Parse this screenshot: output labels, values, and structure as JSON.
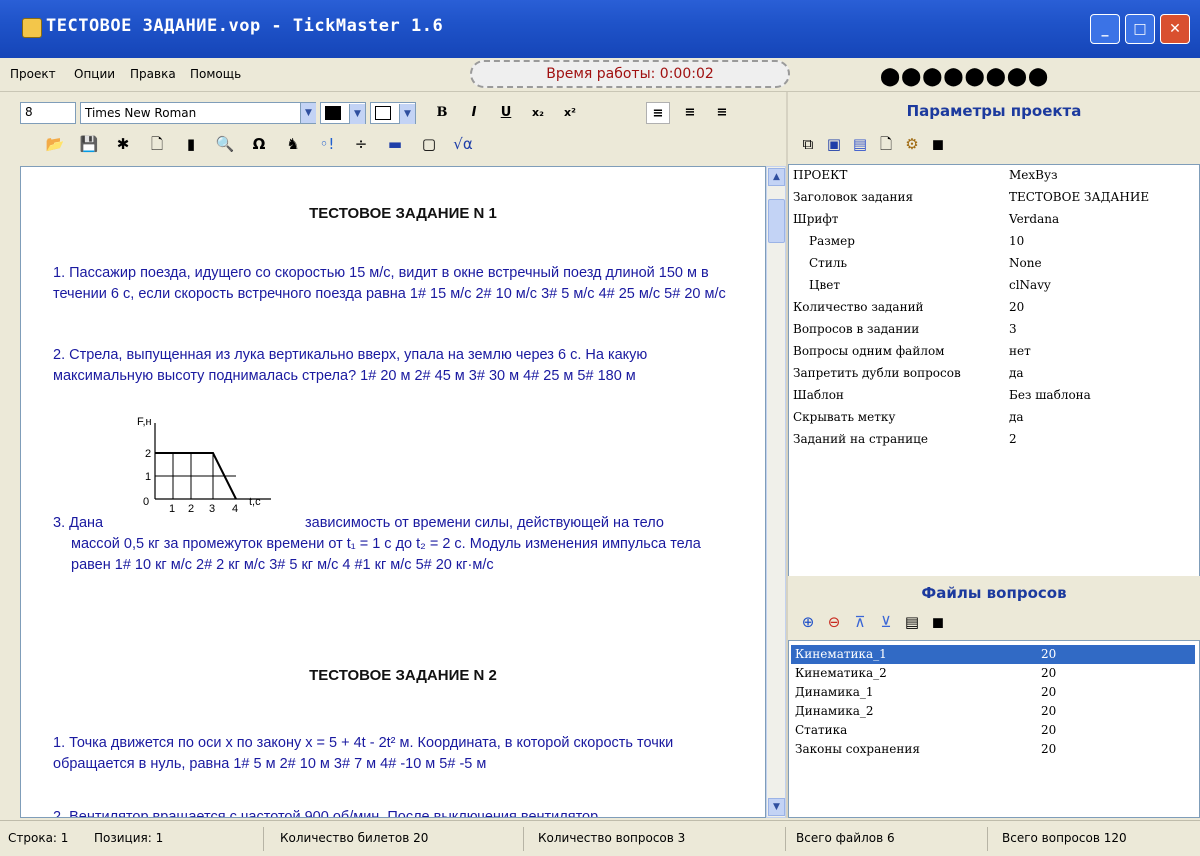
{
  "window": {
    "title": "ТЕСТОВОЕ ЗАДАНИЕ.vop - TickMaster 1.6",
    "min_label": "_",
    "max_label": "□",
    "close_label": "✕"
  },
  "menu": {
    "items": [
      "Проект",
      "Опции",
      "Правка",
      "Помощь"
    ],
    "timer": "Время работы: 0:00:02",
    "chain_glyph": "⬤⬤⬤⬤⬤⬤⬤⬤"
  },
  "format_toolbar": {
    "font_size": "8",
    "font_name": "Times New Roman",
    "bold": "B",
    "italic": "I",
    "underline": "U",
    "subscript": "x₂",
    "superscript": "x²",
    "align_left_icon": "align-left-icon",
    "align_center_icon": "align-center-icon",
    "align_right_icon": "align-right-icon",
    "text_color": "#000000",
    "back_color": "#ffffff"
  },
  "tools": {
    "glyphs": [
      "📂",
      "💾",
      "✱",
      "🗋",
      "▮",
      "🔍",
      "Ω",
      "♞",
      "◦!",
      "÷",
      "▬",
      "▢",
      "√α"
    ]
  },
  "document": {
    "heading1": "ТЕСТОВОЕ ЗАДАНИЕ N 1",
    "q1": "1. Пассажир поезда, идущего со скоростью 15 м/с, видит в окне встречный поезд длиной 150 м в течении 6 с, если скорость встречного поезда равна  1# 15 м/с   2# 10 м/с    3#  5 м/с    4# 25 м/с    5# 20 м/с",
    "q2": "2. Стрела, выпущенная из лука вертикально вверх, упала на землю через 6 с. На какую максимальную высоту поднималась стрела?      1# 20 м   2# 45 м   3# 30 м   4# 25 м   5# 180 м",
    "q3_prefix": "3. Дана",
    "q3_text": "зависимость от времени силы, действующей на тело",
    "q3_rest": "массой 0,5 кг за промежуток времени от  t₁ = 1 с до  t₂ = 2 с. Модуль изменения импульса тела равен    1# 10 кг м/с      2# 2 кг м/с      3# 5 кг м/с      4 #1 кг м/с      5# 20 кг·м/с",
    "graph": {
      "y_axis_label": "F,н",
      "x_axis_label": "t,c",
      "y_ticks": [
        "1",
        "2"
      ],
      "x_ticks": [
        "0",
        "1",
        "2",
        "3",
        "4"
      ]
    },
    "heading2": "ТЕСТОВОЕ ЗАДАНИЕ N 2",
    "q4": "1. Точка движется по оси x по закону x = 5 + 4t - 2t² м. Координата, в которой скорость точки обращается в нуль, равна       1#    5 м   2#  10 м  3#    7 м   4# -10 м    5#  -5 м",
    "q5": "2. Вентилятор вращается с частотой 900 об/мин. После выключения вентилятор"
  },
  "project_panel": {
    "title": "Параметры проекта",
    "toolbar_icons": [
      "copy-icon",
      "save-as-icon",
      "save-icon",
      "new-icon",
      "settings-icon",
      "exit-icon"
    ],
    "rows": [
      {
        "name": "ПРОЕКТ",
        "value": "МехВуз",
        "sub": false
      },
      {
        "name": "Заголовок задания",
        "value": "ТЕСТОВОЕ ЗАДАНИЕ",
        "sub": false
      },
      {
        "name": "Шрифт",
        "value": "Verdana",
        "sub": false
      },
      {
        "name": "Размер",
        "value": "10",
        "sub": true
      },
      {
        "name": "Стиль",
        "value": "None",
        "sub": true
      },
      {
        "name": "Цвет",
        "value": "clNavy",
        "sub": true
      },
      {
        "name": "Количество заданий",
        "value": "20",
        "sub": false
      },
      {
        "name": "Вопросов в задании",
        "value": "3",
        "sub": false
      },
      {
        "name": "Вопросы одним файлом",
        "value": "нет",
        "sub": false
      },
      {
        "name": "Запретить дубли вопросов",
        "value": "да",
        "sub": false
      },
      {
        "name": "Шаблон",
        "value": "Без шаблона",
        "sub": false
      },
      {
        "name": "Скрывать метку",
        "value": "да",
        "sub": false
      },
      {
        "name": "Заданий на странице",
        "value": "2",
        "sub": false
      }
    ]
  },
  "files_panel": {
    "title": "Файлы вопросов",
    "toolbar_icons": [
      "add-icon",
      "remove-icon",
      "move-up-icon",
      "move-down-icon",
      "open-icon",
      "exit-icon"
    ],
    "rows": [
      {
        "name": "Кинематика_1",
        "count": "20",
        "selected": true
      },
      {
        "name": "Кинематика_2",
        "count": "20",
        "selected": false
      },
      {
        "name": "Динамика_1",
        "count": "20",
        "selected": false
      },
      {
        "name": "Динамика_2",
        "count": "20",
        "selected": false
      },
      {
        "name": "Статика",
        "count": "20",
        "selected": false
      },
      {
        "name": "Законы сохранения",
        "count": "20",
        "selected": false
      }
    ]
  },
  "status": {
    "line": "Строка:  1",
    "position": "Позиция:  1",
    "tickets": "Количество билетов 20",
    "questions": "Количество вопросов 3",
    "total_files": "Всего файлов    6",
    "total_questions": "Всего вопросов    120"
  }
}
